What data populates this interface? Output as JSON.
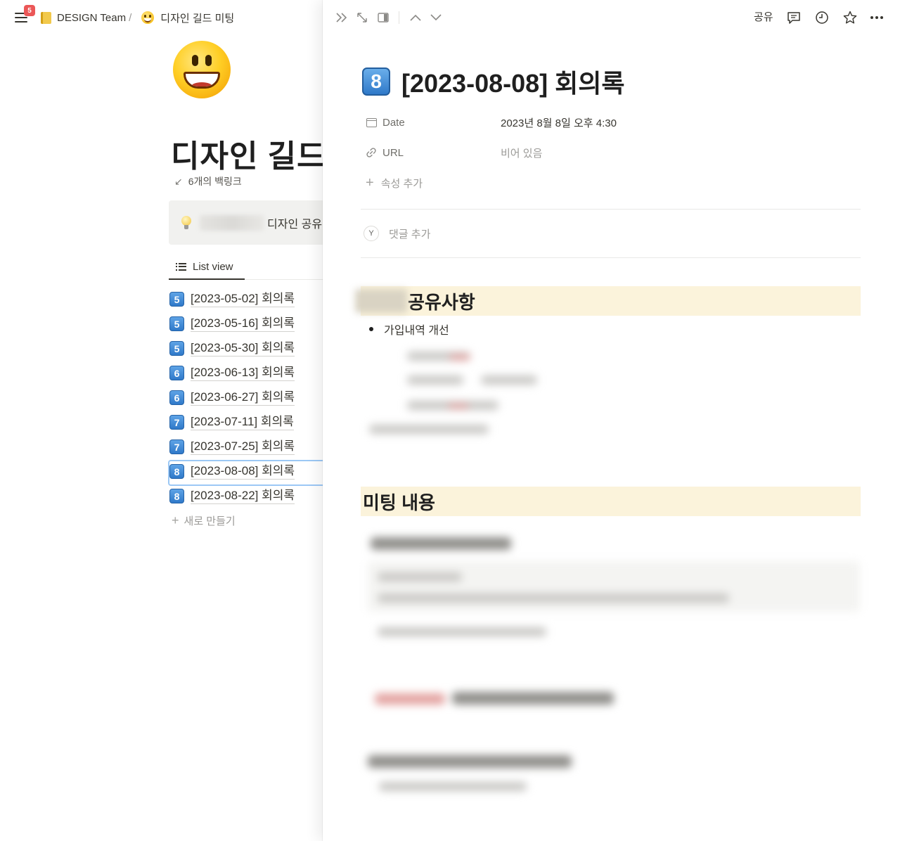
{
  "topbar": {
    "notification_count": "5",
    "breadcrumb": [
      {
        "label": "DESIGN Team",
        "icon": "notebook-icon"
      },
      {
        "label": "디자인 길드 미팅",
        "icon": "grinning-face-icon"
      }
    ],
    "separator": "/"
  },
  "left_page": {
    "icon": "grinning-face-icon",
    "title": "디자인 길드",
    "backlinks": "6개의 백링크",
    "callout": {
      "icon": "light-bulb-icon",
      "text": "디자인 공유"
    },
    "view_tab": "List view",
    "rows": [
      {
        "number": "5",
        "label": "[2023-05-02] 회의록"
      },
      {
        "number": "5",
        "label": "[2023-05-16] 회의록"
      },
      {
        "number": "5",
        "label": "[2023-05-30] 회의록"
      },
      {
        "number": "6",
        "label": "[2023-06-13] 회의록"
      },
      {
        "number": "6",
        "label": "[2023-06-27] 회의록"
      },
      {
        "number": "7",
        "label": "[2023-07-11] 회의록"
      },
      {
        "number": "7",
        "label": "[2023-07-25] 회의록"
      },
      {
        "number": "8",
        "label": "[2023-08-08] 회의록",
        "selected": true
      },
      {
        "number": "8",
        "label": "[2023-08-22] 회의록"
      }
    ],
    "new_label": "새로 만들기"
  },
  "peek": {
    "toolbar": {
      "icons": [
        "collapse-double-chevron-icon",
        "expand-arrows-icon",
        "side-peek-icon",
        "chevron-up-icon",
        "chevron-down-icon",
        "comment-icon",
        "clock-history-icon",
        "star-icon",
        "more-dots-icon"
      ],
      "share": "공유"
    },
    "title_number": "8",
    "title": "[2023-08-08] 회의록",
    "properties": [
      {
        "name": "Date",
        "icon": "calendar-icon",
        "value": "2023년 8월 8일 오후 4:30"
      },
      {
        "name": "URL",
        "icon": "link-icon",
        "value": "비어 있음"
      }
    ],
    "add_property": "속성 추가",
    "comment": {
      "avatar": "Y",
      "placeholder": "댓글 추가"
    },
    "heading_share": "공유사항",
    "bullet_1": "가입내역 개선",
    "heading_meeting": "미팅 내용"
  },
  "colors": {
    "heading_background": "#fbf3db",
    "badge": "#eb5757",
    "keycap": "#2f79c9",
    "selection_outline": "#9cc8f5"
  }
}
